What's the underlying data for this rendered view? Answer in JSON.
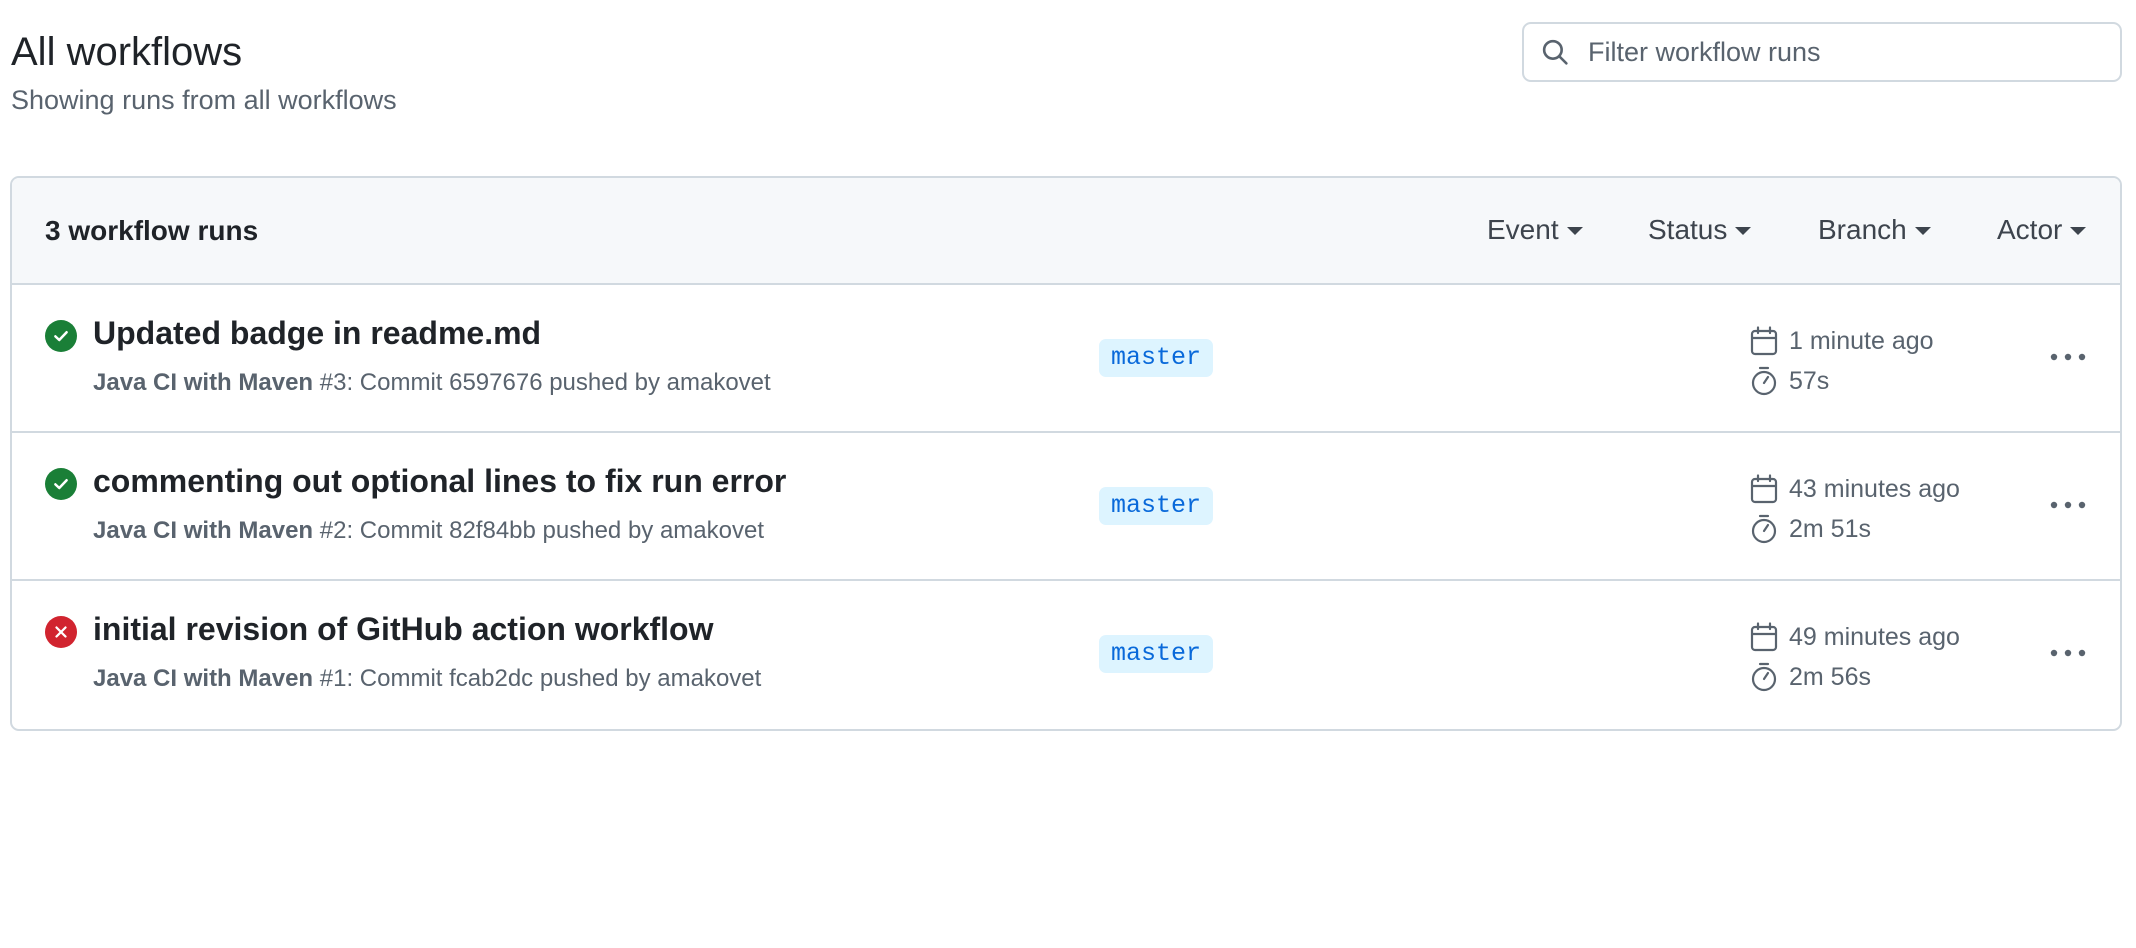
{
  "header": {
    "title": "All workflows",
    "subtitle": "Showing runs from all workflows"
  },
  "search": {
    "placeholder": "Filter workflow runs"
  },
  "runs_box": {
    "count_label": "3 workflow runs",
    "filters": [
      "Event",
      "Status",
      "Branch",
      "Actor"
    ]
  },
  "runs": [
    {
      "status": "success",
      "title": "Updated badge in readme.md",
      "workflow": "Java CI with Maven",
      "meta": " #3: Commit 6597676 pushed by amakovet",
      "branch": "master",
      "when": "1 minute ago",
      "duration": "57s"
    },
    {
      "status": "success",
      "title": "commenting out optional lines to fix run error",
      "workflow": "Java CI with Maven",
      "meta": " #2: Commit 82f84bb pushed by amakovet",
      "branch": "master",
      "when": "43 minutes ago",
      "duration": "2m 51s"
    },
    {
      "status": "failure",
      "title": "initial revision of GitHub action workflow",
      "workflow": "Java CI with Maven",
      "meta": " #1: Commit fcab2dc pushed by amakovet",
      "branch": "master",
      "when": "49 minutes ago",
      "duration": "2m 56s"
    }
  ],
  "colors": {
    "success": "#1a7f37",
    "failure": "#d1242f",
    "branch_bg": "#ddf4ff",
    "branch_text": "#0969da"
  },
  "icons": {
    "search": "search-icon",
    "calendar": "calendar-icon",
    "stopwatch": "stopwatch-icon",
    "success": "check-circle-icon",
    "failure": "x-circle-icon",
    "menu": "kebab-horizontal-icon",
    "dropdown": "triangle-down-icon"
  }
}
